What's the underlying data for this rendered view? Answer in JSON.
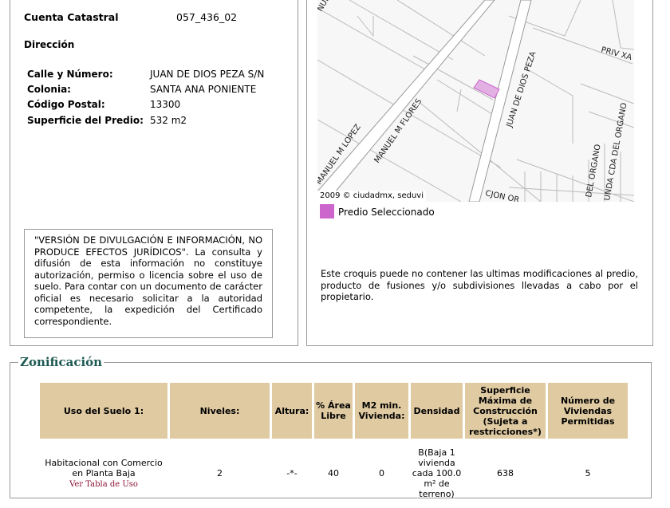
{
  "predio": {
    "cuenta_label": "Cuenta Catastral",
    "cuenta_value": "057_436_02",
    "direccion_label": "Dirección",
    "calle_label": "Calle y Número:",
    "calle_value": "JUAN DE DIOS PEZA S/N",
    "colonia_label": "Colonia:",
    "colonia_value": "SANTA ANA PONIENTE",
    "cp_label": "Código Postal:",
    "cp_value": "13300",
    "superficie_label": "Superficie del Predio:",
    "superficie_value": "532 m2"
  },
  "disclaimer": "\"VERSIÓN DE DIVULGACIÓN E INFORMACIÓN, NO PRODUCE EFECTOS JURÍDICOS\". La consulta y difusión de esta información no constituye autorización, permiso o licencia sobre el uso de suelo. Para contar con un documento de carácter oficial es necesario solicitar a la autoridad competente, la expedición del Certificado correspondiente.",
  "map": {
    "streets": [
      "JUAN DE DIOS PEZA",
      "MANUEL M FLORES",
      "MANUEL M LOPEZ",
      "PRIV XA",
      "DEL ORGANO",
      "UNDA CDA DEL ORGANO",
      "CJON OR",
      "NUE"
    ],
    "copyright": "2009 © ciudadmx, seduvi",
    "legend_label": "Predio Seleccionado",
    "legend_color": "#cc66cc"
  },
  "note": "Este croquis puede no contener las ultimas modificaciones al predio, producto de fusiones y/o subdivisiones llevadas a cabo por el propietario.",
  "zonificacion": {
    "title": "Zonificación",
    "headers": [
      "Uso del Suelo 1:",
      "Niveles:",
      "Altura:",
      "% Área Libre",
      "M2 min. Vivienda:",
      "Densidad",
      "Superficie Máxima de Construcción (Sujeta a restricciones*)",
      "Número de Viviendas Permitidas"
    ],
    "row": {
      "uso": "Habitacional con Comercio en Planta Baja",
      "link": "Ver Tabla de Uso",
      "niveles": "2",
      "altura": "-*-",
      "area_libre": "40",
      "m2_min": "0",
      "densidad": "B(Baja 1 vivienda cada 100.0 m² de terreno)",
      "superficie_max": "638",
      "viviendas": "5"
    }
  }
}
